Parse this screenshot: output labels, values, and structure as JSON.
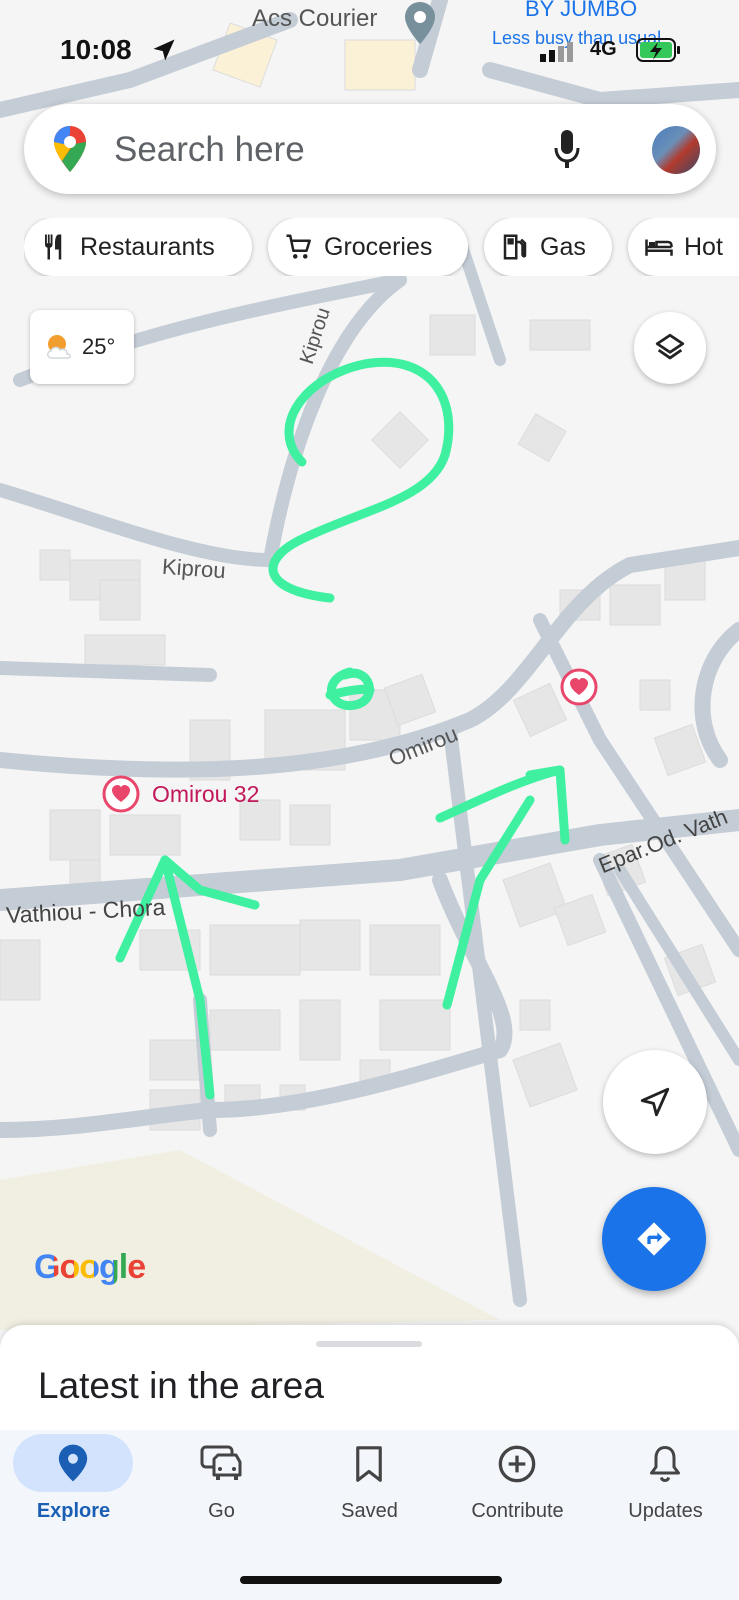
{
  "status_bar": {
    "time": "10:08",
    "network": "4G"
  },
  "search": {
    "placeholder": "Search here"
  },
  "chips": [
    {
      "label": "Restaurants",
      "icon": "fork-knife-icon"
    },
    {
      "label": "Groceries",
      "icon": "cart-icon"
    },
    {
      "label": "Gas",
      "icon": "gas-pump-icon"
    },
    {
      "label": "Hot",
      "icon": "bed-icon"
    }
  ],
  "weather": {
    "temp": "25°",
    "icon": "partly-cloudy-icon"
  },
  "map": {
    "poi_top": "Acs Courier",
    "poi_top_right": "BY JUMBO",
    "poi_top_right_sub": "Less busy than usual",
    "streets": [
      "Kiprou",
      "Kiprou",
      "Omirou",
      "Vathiou - Chora",
      "Epar.Od. Vath"
    ],
    "place": "Omirou 32",
    "attribution": "Google"
  },
  "sheet": {
    "title": "Latest in the area"
  },
  "nav": [
    {
      "label": "Explore",
      "icon": "pin-icon",
      "active": true
    },
    {
      "label": "Go",
      "icon": "car-icon",
      "active": false
    },
    {
      "label": "Saved",
      "icon": "bookmark-icon",
      "active": false
    },
    {
      "label": "Contribute",
      "icon": "plus-circle-icon",
      "active": false
    },
    {
      "label": "Updates",
      "icon": "bell-icon",
      "active": false
    }
  ],
  "colors": {
    "accent": "#1a73e8",
    "annotation": "#3ef0a0",
    "saved_pin": "#e8466a",
    "road": "#c4ccd6"
  }
}
